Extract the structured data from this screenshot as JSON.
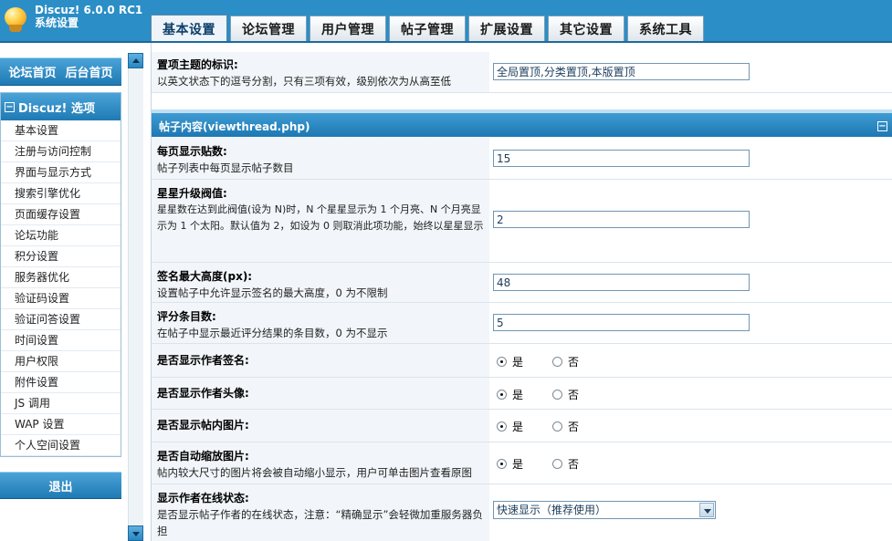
{
  "app": {
    "name": "Discuz! 6.0.0 RC1",
    "subtitle": "系统设置"
  },
  "tabs": [
    "基本设置",
    "论坛管理",
    "用户管理",
    "帖子管理",
    "扩展设置",
    "其它设置",
    "系统工具"
  ],
  "sidebar": {
    "top_links": [
      "论坛首页",
      "后台首页"
    ],
    "menu_title": "Discuz! 选项",
    "items": [
      "基本设置",
      "注册与访问控制",
      "界面与显示方式",
      "搜索引擎优化",
      "页面缓存设置",
      "论坛功能",
      "积分设置",
      "服务器优化",
      "验证码设置",
      "验证问答设置",
      "时间设置",
      "用户权限",
      "附件设置",
      "JS 调用",
      "WAP 设置",
      "个人空间设置"
    ],
    "logout": "退出"
  },
  "top_row": {
    "title": "置项主题的标识:",
    "desc": "以英文状态下的逗号分割，只有三项有效，级别依次为从高至低",
    "value": "全局置顶,分类置顶,本版置顶"
  },
  "section": {
    "title": "帖子内容(viewthread.php)"
  },
  "settings": {
    "posts_per_page": {
      "title": "每页显示贴数:",
      "desc": "帖子列表中每页显示帖子数目",
      "value": "15"
    },
    "star_threshold": {
      "title": "星星升级阀值:",
      "desc": "星星数在达到此阀值(设为 N)时，N 个星星显示为 1 个月亮、N 个月亮显示为 1 个太阳。默认值为 2，如设为 0 则取消此项功能，始终以星星显示",
      "value": "2"
    },
    "sig_height": {
      "title": "签名最大高度(px):",
      "desc": "设置帖子中允许显示签名的最大高度，0 为不限制",
      "value": "48"
    },
    "rating_count": {
      "title": "评分条目数:",
      "desc": "在帖子中显示最近评分结果的条目数，0 为不显示",
      "value": "5"
    },
    "show_signature": {
      "title": "是否显示作者签名:",
      "yes": "是",
      "no": "否"
    },
    "show_avatar": {
      "title": "是否显示作者头像:",
      "yes": "是",
      "no": "否"
    },
    "show_images": {
      "title": "是否显示帖内图片:",
      "yes": "是",
      "no": "否"
    },
    "auto_resize": {
      "title": "是否自动缩放图片:",
      "desc": "帖内较大尺寸的图片将会被自动缩小显示，用户可单击图片查看原图",
      "yes": "是",
      "no": "否"
    },
    "online_status": {
      "title": "显示作者在线状态:",
      "desc": "是否显示帖子作者的在线状态，注意：“精确显示”会轻微加重服务器负担",
      "selected": "快速显示（推荐使用）"
    }
  },
  "colors": {
    "header": "#2b8ec6",
    "accent": "#1d78b3",
    "label_bg": "#f2f6fa"
  }
}
